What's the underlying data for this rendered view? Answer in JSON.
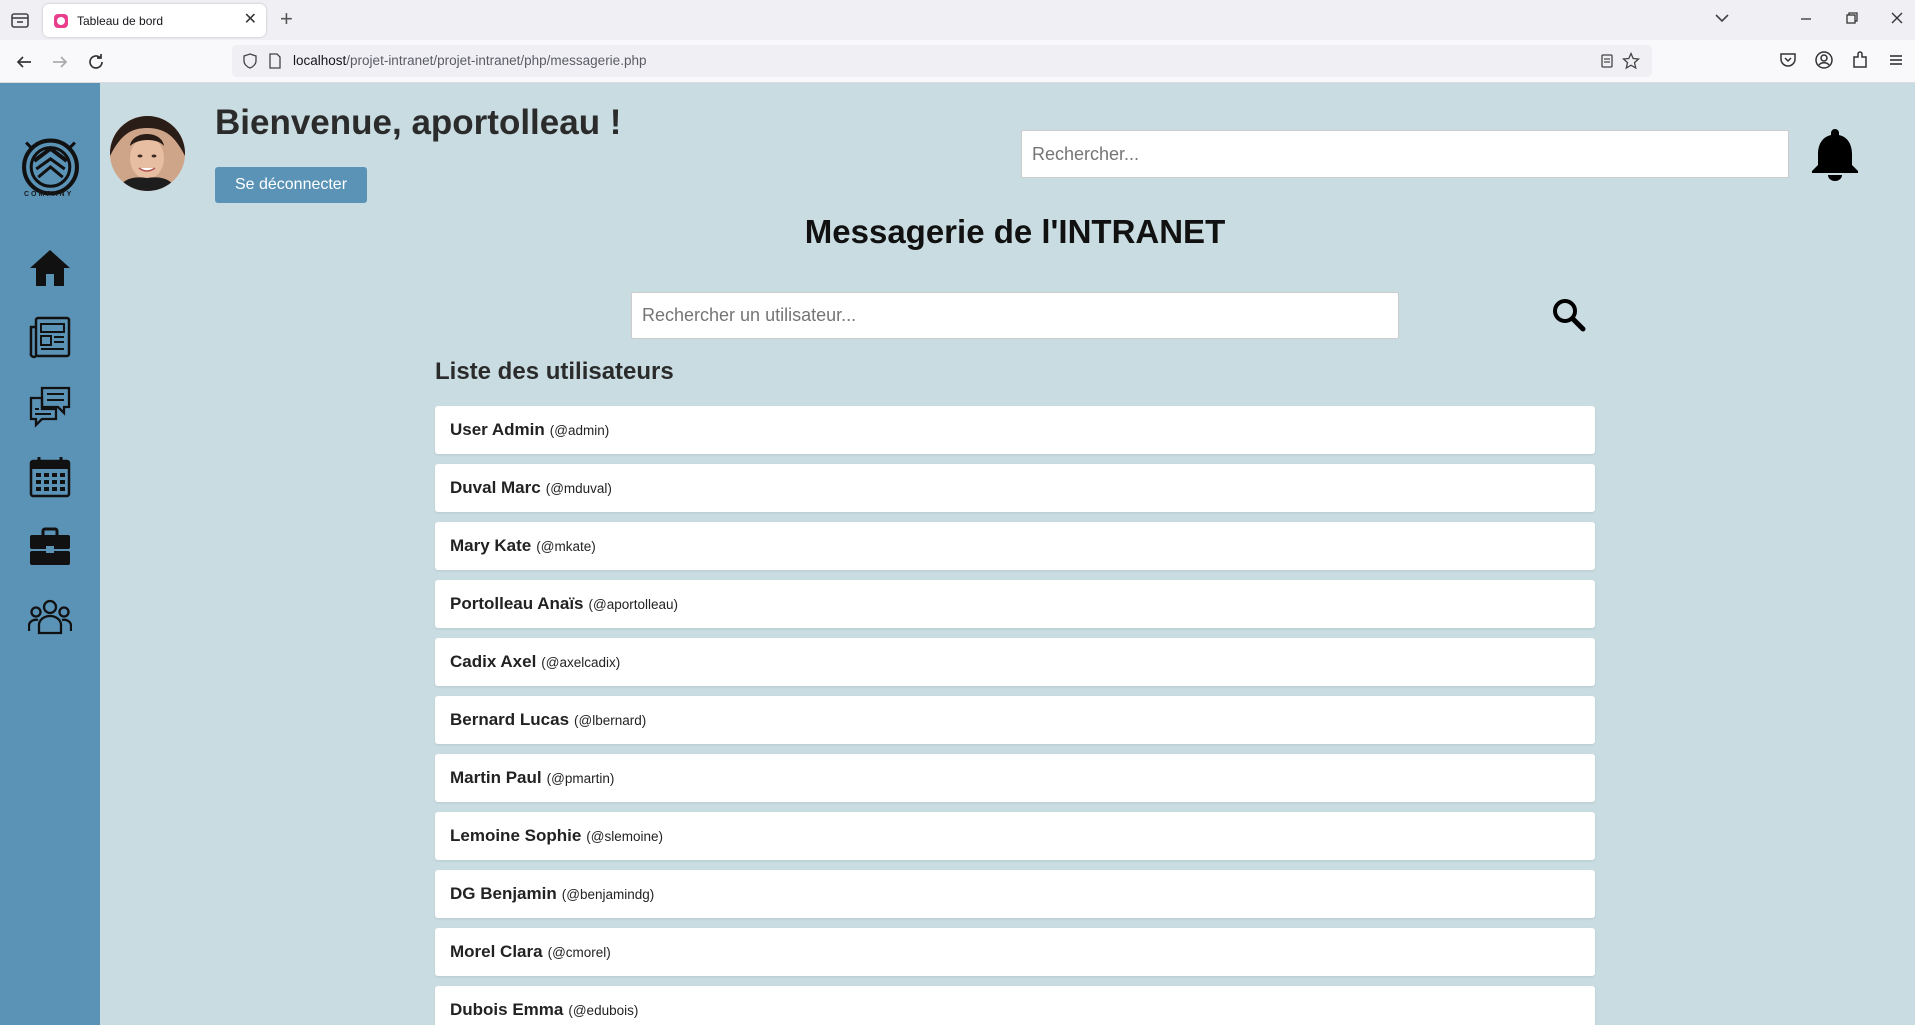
{
  "browser": {
    "tab_title": "Tableau de bord",
    "url_host": "localhost",
    "url_path": "/projet-intranet/projet-intranet/php/messagerie.php"
  },
  "sidebar": {
    "logo_text": "COMPANY",
    "items": [
      {
        "icon": "home-icon"
      },
      {
        "icon": "newspaper-icon"
      },
      {
        "icon": "chat-icon"
      },
      {
        "icon": "calendar-icon"
      },
      {
        "icon": "briefcase-icon"
      },
      {
        "icon": "team-icon"
      }
    ]
  },
  "header": {
    "welcome": "Bienvenue, aportolleau !",
    "logout_label": "Se déconnecter",
    "search_placeholder": "Rechercher..."
  },
  "main": {
    "title": "Messagerie de l'INTRANET",
    "user_search_placeholder": "Rechercher un utilisateur...",
    "list_heading": "Liste des utilisateurs",
    "users": [
      {
        "name": "User Admin",
        "handle": "(@admin)"
      },
      {
        "name": "Duval Marc",
        "handle": "(@mduval)"
      },
      {
        "name": "Mary Kate",
        "handle": "(@mkate)"
      },
      {
        "name": "Portolleau Anaïs",
        "handle": "(@aportolleau)"
      },
      {
        "name": "Cadix Axel",
        "handle": "(@axelcadix)"
      },
      {
        "name": "Bernard Lucas",
        "handle": "(@lbernard)"
      },
      {
        "name": "Martin Paul",
        "handle": "(@pmartin)"
      },
      {
        "name": "Lemoine Sophie",
        "handle": "(@slemoine)"
      },
      {
        "name": "DG Benjamin",
        "handle": "(@benjamindg)"
      },
      {
        "name": "Morel Clara",
        "handle": "(@cmorel)"
      },
      {
        "name": "Dubois Emma",
        "handle": "(@edubois)"
      }
    ]
  },
  "colors": {
    "page_bg": "#c8dce1",
    "sidebar_bg": "#5b93b7",
    "button_bg": "#5b93b7"
  }
}
